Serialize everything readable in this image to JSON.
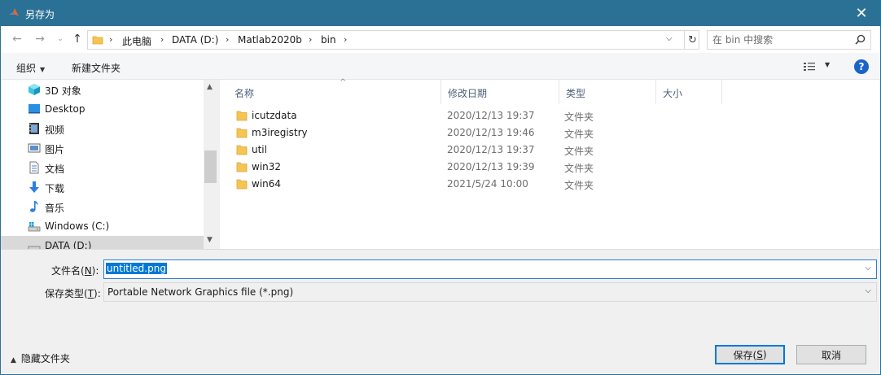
{
  "window": {
    "title": "另存为",
    "close_glyph": "✕"
  },
  "address": {
    "breadcrumbs": [
      {
        "label": "此电脑"
      },
      {
        "label": "DATA (D:)"
      },
      {
        "label": "Matlab2020b"
      },
      {
        "label": "bin"
      }
    ],
    "search_placeholder": "在 bin 中搜索"
  },
  "toolbar": {
    "organize_label": "组织",
    "new_folder_label": "新建文件夹"
  },
  "nav": {
    "items": [
      {
        "label": "3D 对象",
        "icon": "3d-objects-icon"
      },
      {
        "label": "Desktop",
        "icon": "desktop-icon"
      },
      {
        "label": "视频",
        "icon": "video-icon"
      },
      {
        "label": "图片",
        "icon": "pictures-icon"
      },
      {
        "label": "文档",
        "icon": "documents-icon"
      },
      {
        "label": "下载",
        "icon": "download-icon"
      },
      {
        "label": "音乐",
        "icon": "music-icon"
      },
      {
        "label": "Windows (C:)",
        "icon": "drive-c-icon"
      },
      {
        "label": "DATA (D:)",
        "icon": "drive-d-icon",
        "selected": true
      }
    ]
  },
  "files": {
    "columns": [
      "名称",
      "修改日期",
      "类型",
      "大小"
    ],
    "rows": [
      {
        "name": "icutzdata",
        "date": "2020/12/13 19:37",
        "type": "文件夹"
      },
      {
        "name": "m3iregistry",
        "date": "2020/12/13 19:46",
        "type": "文件夹"
      },
      {
        "name": "util",
        "date": "2020/12/13 19:37",
        "type": "文件夹"
      },
      {
        "name": "win32",
        "date": "2020/12/13 19:39",
        "type": "文件夹"
      },
      {
        "name": "win64",
        "date": "2021/5/24 10:00",
        "type": "文件夹"
      }
    ]
  },
  "form": {
    "filename_label_prefix": "文件名(",
    "filename_label_key": "N",
    "filename_label_suffix": "):",
    "filename_value": "untitled.png",
    "filetype_label_prefix": "保存类型(",
    "filetype_label_key": "T",
    "filetype_label_suffix": "):",
    "filetype_value": "Portable Network Graphics file (*.png)",
    "hide_folders_label": "隐藏文件夹"
  },
  "buttons": {
    "save_prefix": "保存(",
    "save_key": "S",
    "save_suffix": ")",
    "cancel": "取消"
  },
  "colors": {
    "titlebar": "#2b7196",
    "selection": "#0078d7",
    "folder": "#f5c451",
    "help": "#1a64c8"
  }
}
